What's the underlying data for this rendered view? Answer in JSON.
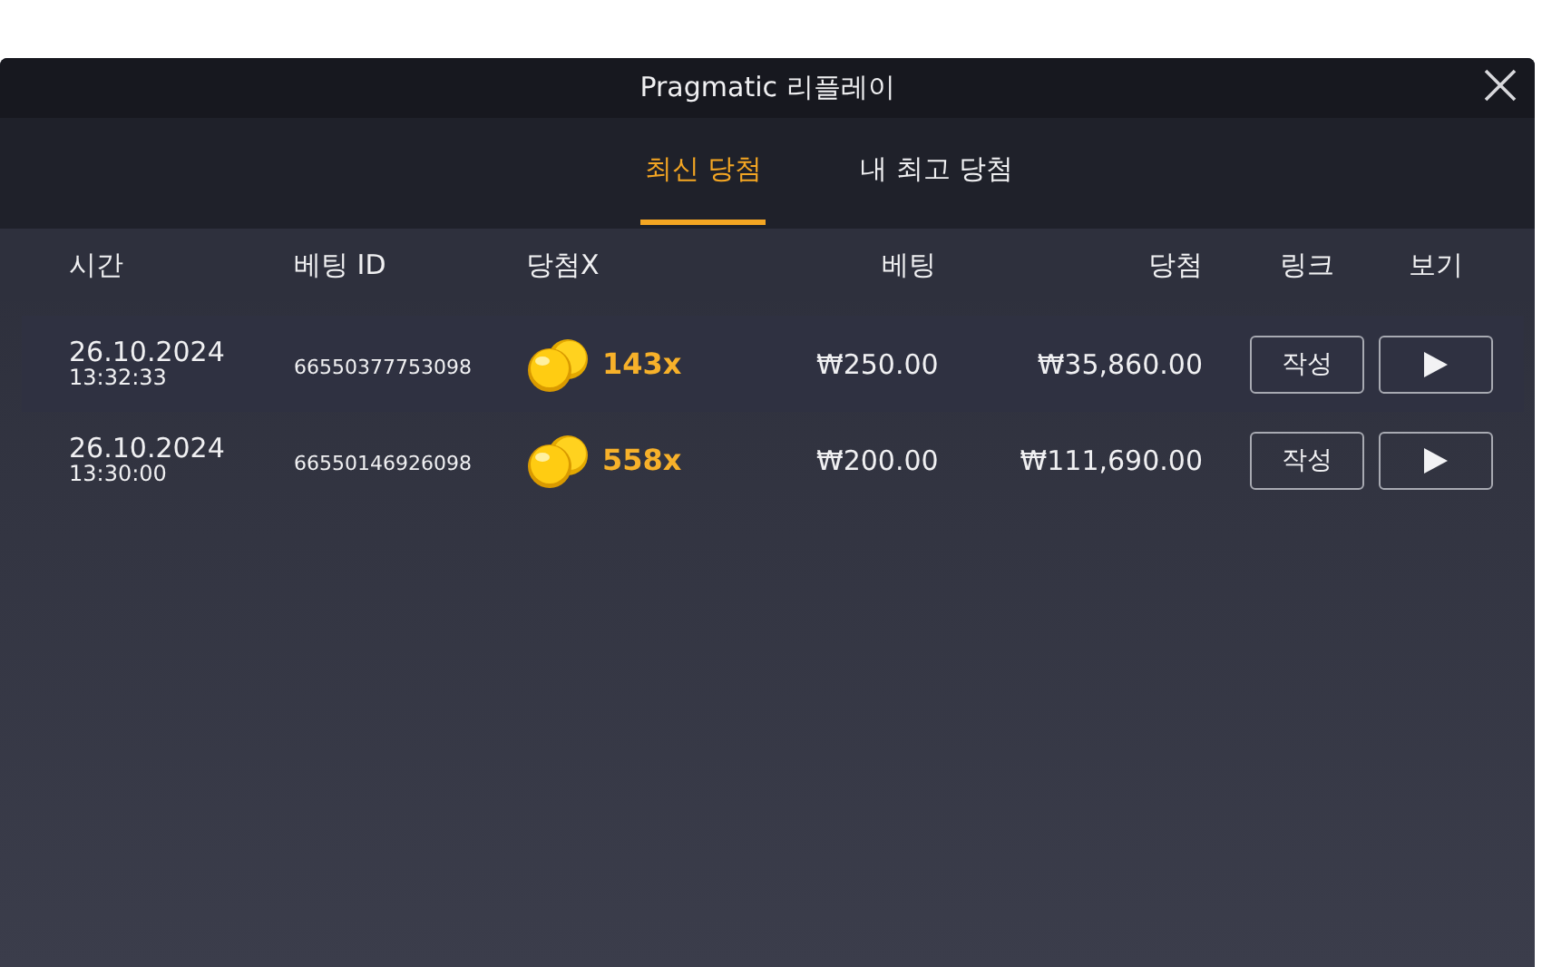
{
  "window": {
    "title": "Pragmatic 리플레이"
  },
  "tabs": [
    {
      "label": "최신 당첨",
      "selected": true
    },
    {
      "label": "내 최고 당첨",
      "selected": false
    }
  ],
  "table": {
    "columns": [
      "시간",
      "베팅 ID",
      "당첨X",
      "베팅",
      "당첨",
      "링크",
      "보기"
    ],
    "rows": [
      {
        "date": "26.10.2024",
        "time": "13:32:33",
        "bet_id": "66550377753098",
        "multiplier": "143x",
        "bet": "₩250.00",
        "win": "₩35,860.00",
        "link": "작성"
      },
      {
        "date": "26.10.2024",
        "time": "13:30:00",
        "bet_id": "66550146926098",
        "multiplier": "558x",
        "bet": "₩200.00",
        "win": "₩111,690.00",
        "link": "작성"
      }
    ]
  }
}
